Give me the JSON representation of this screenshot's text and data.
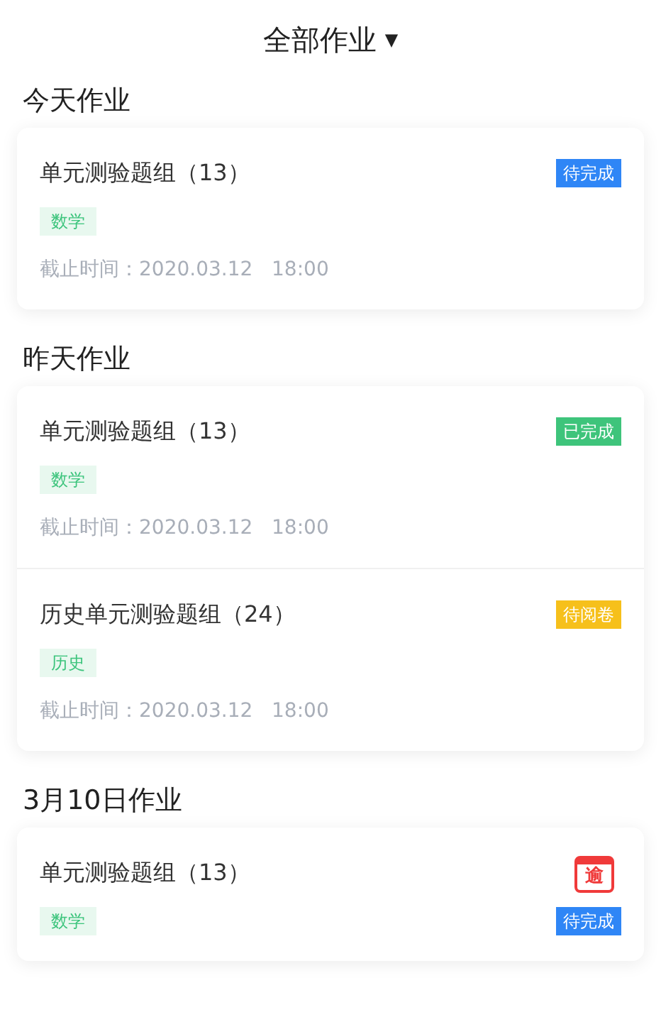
{
  "header": {
    "title": "全部作业",
    "caret": "▼"
  },
  "sections": [
    {
      "heading": "今天作业",
      "items": [
        {
          "title": "单元测验题组（13）",
          "status": {
            "kind": "pending",
            "label": "待完成"
          },
          "subject": "数学",
          "deadline": "截止时间：2020.03.12   18:00"
        }
      ]
    },
    {
      "heading": "昨天作业",
      "items": [
        {
          "title": "单元测验题组（13）",
          "status": {
            "kind": "done",
            "label": "已完成"
          },
          "subject": "数学",
          "deadline": "截止时间：2020.03.12   18:00"
        },
        {
          "title": "历史单元测验题组（24）",
          "status": {
            "kind": "review",
            "label": "待阅卷"
          },
          "subject": "历史",
          "deadline": "截止时间：2020.03.12   18:00"
        }
      ]
    },
    {
      "heading": "3月10日作业",
      "items": [
        {
          "title": "单元测验题组（13）",
          "overdue": "逾",
          "status": {
            "kind": "pending",
            "label": "待完成"
          },
          "subject": "数学"
        }
      ]
    }
  ]
}
